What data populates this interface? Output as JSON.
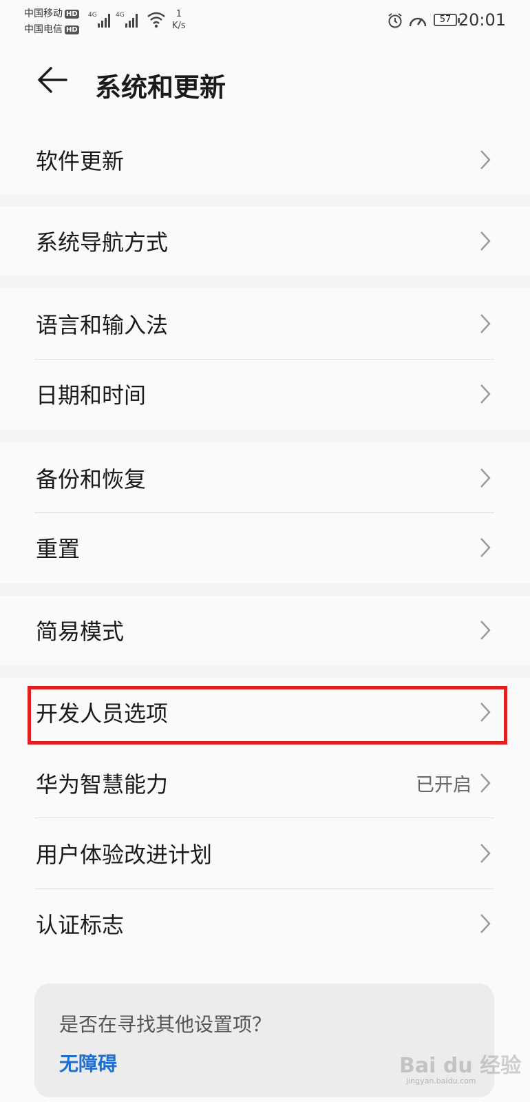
{
  "status_bar": {
    "carrier1": "中国移动",
    "carrier2": "中国电信",
    "hd_badge": "HD",
    "net_type": "4G",
    "net_speed_value": "1",
    "net_speed_unit": "K/s",
    "battery": "57",
    "time": "20:01"
  },
  "header": {
    "title": "系统和更新"
  },
  "sections": [
    {
      "items": [
        {
          "label": "软件更新"
        }
      ]
    },
    {
      "items": [
        {
          "label": "系统导航方式"
        }
      ]
    },
    {
      "items": [
        {
          "label": "语言和输入法"
        },
        {
          "label": "日期和时间"
        }
      ]
    },
    {
      "items": [
        {
          "label": "备份和恢复"
        },
        {
          "label": "重置"
        }
      ]
    },
    {
      "items": [
        {
          "label": "简易模式"
        }
      ]
    },
    {
      "items": [
        {
          "label": "开发人员选项"
        },
        {
          "label": "华为智慧能力",
          "value": "已开启"
        },
        {
          "label": "用户体验改进计划"
        },
        {
          "label": "认证标志"
        }
      ]
    }
  ],
  "search_card": {
    "question": "是否在寻找其他设置项？",
    "link": "无障碍"
  },
  "watermark": {
    "text": "Bai du 经验",
    "sub": "jingyan.baidu.com"
  },
  "colors": {
    "background": "#f4f4f4",
    "card": "#fafafa",
    "highlight": "#e02020",
    "link": "#1f6fd1"
  }
}
